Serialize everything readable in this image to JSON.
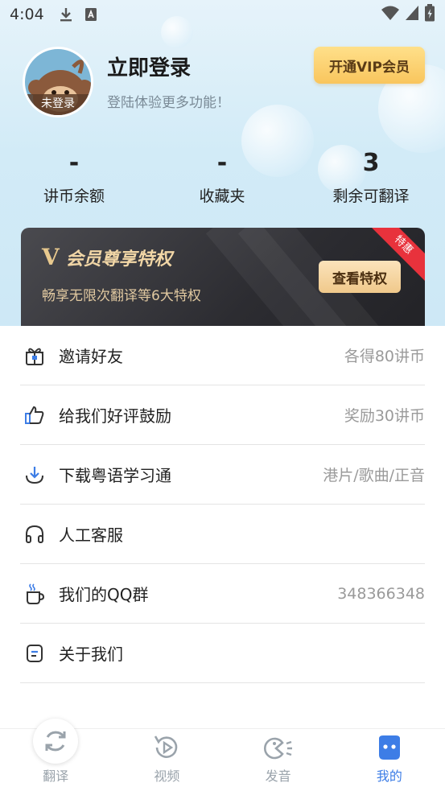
{
  "status_bar": {
    "time": "4:04"
  },
  "profile": {
    "avatar_tag": "未登录",
    "title": "立即登录",
    "subtitle": "登陆体验更多功能！",
    "vip_button": "开通VIP会员"
  },
  "stats": [
    {
      "value": "-",
      "label": "讲币余额"
    },
    {
      "value": "-",
      "label": "收藏夹"
    },
    {
      "value": "3",
      "label": "剩余可翻译"
    }
  ],
  "vip_card": {
    "v_mark": "V",
    "title": "会员尊享特权",
    "description": "畅享无限次翻译等6大特权",
    "button": "查看特权",
    "ribbon": "特惠"
  },
  "menu": [
    {
      "icon": "gift-icon",
      "label": "邀请好友",
      "value": "各得80讲币"
    },
    {
      "icon": "thumbs-up-icon",
      "label": "给我们好评鼓励",
      "value": "奖励30讲币"
    },
    {
      "icon": "download-icon",
      "label": "下载粤语学习通",
      "value": "港片/歌曲/正音"
    },
    {
      "icon": "headphones-icon",
      "label": "人工客服",
      "value": ""
    },
    {
      "icon": "coffee-cup-icon",
      "label": "我们的QQ群",
      "value": "348366348"
    },
    {
      "icon": "info-icon",
      "label": "关于我们",
      "value": ""
    }
  ],
  "tabs": [
    {
      "icon": "translate-icon",
      "label": "翻译"
    },
    {
      "icon": "video-icon",
      "label": "视频"
    },
    {
      "icon": "pronunciation-icon",
      "label": "发音"
    },
    {
      "icon": "mine-icon",
      "label": "我的"
    }
  ],
  "colors": {
    "accent": "#3d7de6",
    "vip_gold": "#f9c55d",
    "ribbon_red": "#e8323c"
  }
}
